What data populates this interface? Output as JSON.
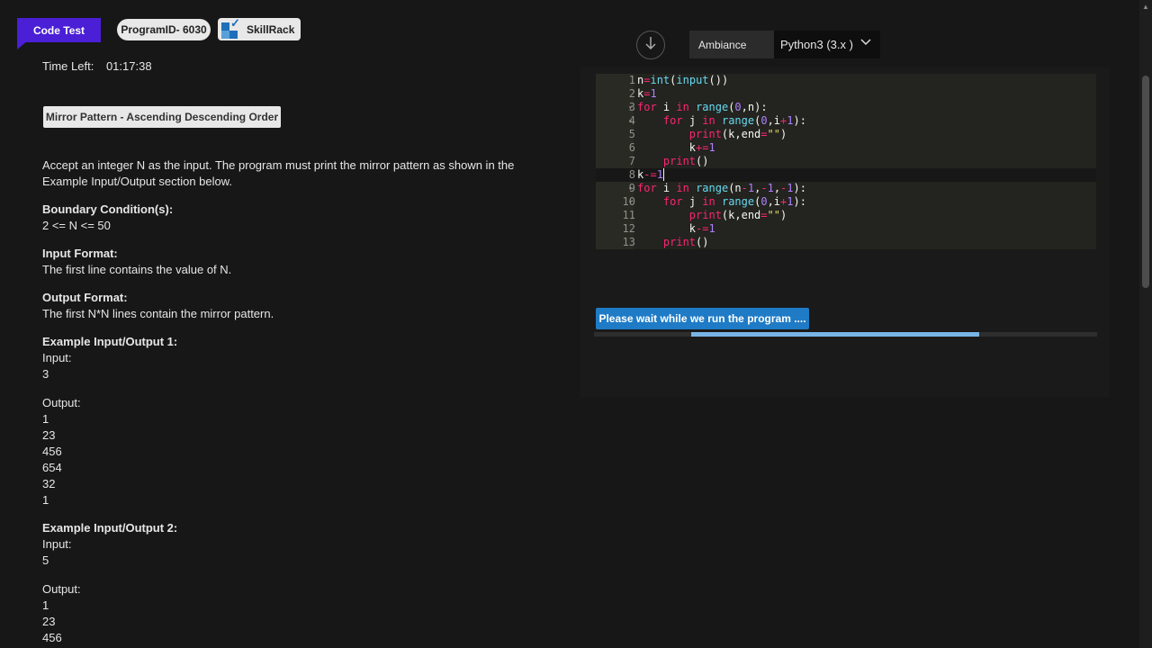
{
  "header": {
    "code_test_label": "Code Test",
    "program_id_label": "ProgramID- 6030",
    "brand_label": "SkillRack",
    "time_left_label": "Time Left:",
    "time_left_value": "01:17:38"
  },
  "problem": {
    "title": "Mirror Pattern - Ascending Descending Order",
    "description": "Accept an integer N as the input. The program must print the mirror pattern as shown in the Example Input/Output section below.",
    "boundary_heading": "Boundary Condition(s):",
    "boundary_text": "2 <= N <= 50",
    "input_heading": "Input Format:",
    "input_text": "The first line contains the value of N.",
    "output_heading": "Output Format:",
    "output_text": "The first N*N lines contain the mirror pattern.",
    "example1_heading": "Example Input/Output 1:",
    "example1_input_label": "Input:",
    "example1_input": "3",
    "example1_output_label": "Output:",
    "example1_output": [
      "1",
      "23",
      "456",
      "654",
      "32",
      "1"
    ],
    "example2_heading": "Example Input/Output 2:",
    "example2_input_label": "Input:",
    "example2_input": "5",
    "example2_output_label": "Output:",
    "example2_output": [
      "1",
      "23",
      "456"
    ]
  },
  "toolbar": {
    "ambiance_label": "Ambiance",
    "language_value": "Python3 (3.x )"
  },
  "editor": {
    "line_numbers": [
      "1",
      "2",
      "3",
      "4",
      "5",
      "6",
      "7",
      "8",
      "9",
      "10",
      "11",
      "12",
      "13"
    ],
    "highlighted_lines": [
      8
    ]
  },
  "run": {
    "status_label": "Please wait while we run the program ....",
    "progress_start": 0.194,
    "progress_end": 0.767
  },
  "colors": {
    "accent_purple": "#4b1fd6",
    "run_blue": "#1f7bc6",
    "progress_fill": "#79b4e6"
  }
}
